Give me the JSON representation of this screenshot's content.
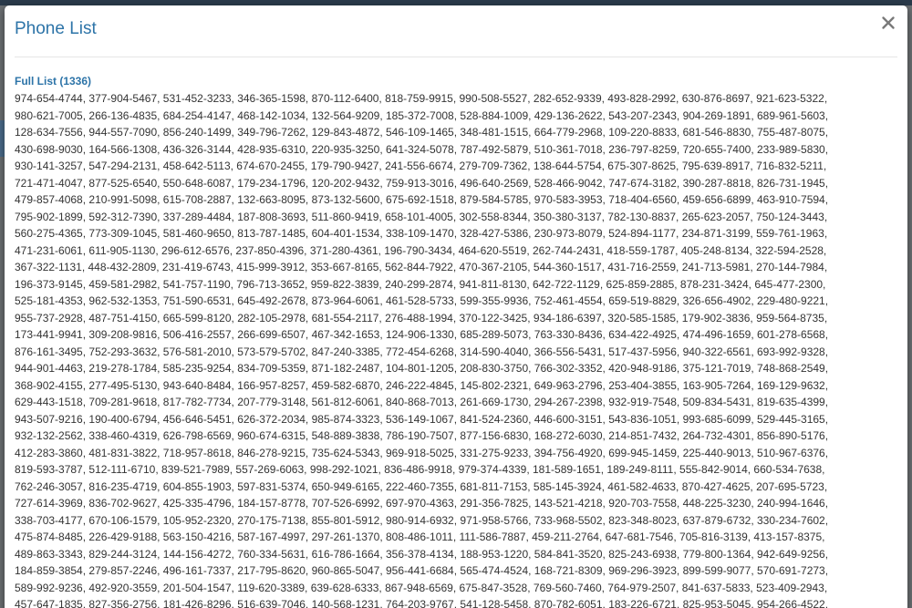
{
  "modal": {
    "title": "Phone List",
    "close_label": "×",
    "list_heading": "Full List (1336)",
    "lines": [
      "974-654-4744, 377-904-5467, 531-452-3233, 346-365-1598, 870-112-6400, 818-759-9915, 990-508-5527, 282-652-9339, 493-828-2992, 630-876-8697, 921-623-5322,",
      "980-621-7005, 266-136-4835, 684-254-4147, 468-142-1034, 132-564-9209, 185-372-7008, 528-884-1009, 429-136-2622, 543-207-2343, 904-269-1891, 689-961-5603,",
      "128-634-7556, 944-557-7090, 856-240-1499, 349-796-7262, 129-843-4872, 546-109-1465, 348-481-1515, 664-779-2968, 109-220-8833, 681-546-8830, 755-487-8075,",
      "430-698-9030, 164-566-1308, 436-326-3144, 428-935-6310, 220-935-3250, 641-324-5078, 787-492-5879, 510-361-7018, 236-797-8259, 720-655-7400, 233-989-5830,",
      "930-141-3257, 547-294-2131, 458-642-5113, 674-670-2455, 179-790-9427, 241-556-6674, 279-709-7362, 138-644-5754, 675-307-8625, 795-639-8917, 716-832-5211,",
      "721-471-4047, 877-525-6540, 550-648-6087, 179-234-1796, 120-202-9432, 759-913-3016, 496-640-2569, 528-466-9042, 747-674-3182, 390-287-8818, 826-731-1945,",
      "479-857-4068, 210-991-5098, 615-708-2887, 132-663-8095, 873-132-5600, 675-692-1518, 879-584-5785, 970-583-3953, 718-404-6560, 459-656-6899, 463-910-7594,",
      "795-902-1899, 592-312-7390, 337-289-4484, 187-808-3693, 511-860-9419, 658-101-4005, 302-558-8344, 350-380-3137, 782-130-8837, 265-623-2057, 750-124-3443,",
      "560-275-4365, 773-309-1045, 581-460-9650, 813-787-1485, 604-401-1534, 338-109-1470, 328-427-5386, 230-973-8079, 524-894-1177, 234-871-3199, 559-761-1963,",
      "471-231-6061, 611-905-1130, 296-612-6576, 237-850-4396, 371-280-4361, 196-790-3434, 464-620-5519, 262-744-2431, 418-559-1787, 405-248-8134, 322-594-2528,",
      "367-322-1131, 448-432-2809, 231-419-6743, 415-999-3912, 353-667-8165, 562-844-7922, 470-367-2105, 544-360-1517, 431-716-2559, 241-713-5981, 270-144-7984,",
      "196-373-9145, 459-581-2982, 541-757-1190, 796-713-3652, 959-822-3839, 240-299-2874, 941-811-8130, 642-722-1129, 625-859-2885, 878-231-3424, 645-477-2300,",
      "525-181-4353, 962-532-1353, 751-590-6531, 645-492-2678, 873-964-6061, 461-528-5733, 599-355-9936, 752-461-4554, 659-519-8829, 326-656-4902, 229-480-9221,",
      "955-737-2928, 487-751-4150, 665-599-8120, 282-105-2978, 681-554-2117, 276-488-1994, 370-122-3425, 934-186-6397, 320-585-1585, 179-902-3836, 959-564-8735,",
      "173-441-9941, 309-208-9816, 506-416-2557, 266-699-6507, 467-342-1653, 124-906-1330, 685-289-5073, 763-330-8436, 634-422-4925, 474-496-1659, 601-278-6568,",
      "876-161-3495, 752-293-3632, 576-581-2010, 573-579-5702, 847-240-3385, 772-454-6268, 314-590-4040, 366-556-5431, 517-437-5956, 940-322-6561, 693-992-9328,",
      "944-901-4463, 219-278-1784, 585-235-9254, 834-709-5359, 871-182-2487, 104-801-1205, 208-830-3750, 766-302-3352, 420-948-9186, 375-121-7019, 748-868-2549,",
      "368-902-4155, 277-495-5130, 943-640-8484, 166-957-8257, 459-582-6870, 246-222-4845, 145-802-2321, 649-963-2796, 253-404-3855, 163-905-7264, 169-129-9632,",
      "629-443-1518, 709-281-9618, 817-782-7734, 207-779-3148, 561-812-6061, 840-868-7013, 261-669-1730, 294-267-2398, 932-919-7548, 509-834-5431, 819-635-4399,",
      "943-507-9216, 190-400-6794, 456-646-5451, 626-372-2034, 985-874-3323, 536-149-1067, 841-524-2360, 446-600-3151, 543-836-1051, 993-685-6099, 529-445-3165,",
      "932-132-2562, 338-460-4319, 626-798-6569, 960-674-6315, 548-889-3838, 786-190-7507, 877-156-6830, 168-272-6030, 214-851-7432, 264-732-4301, 856-890-5176,",
      "412-283-3860, 481-831-3822, 718-957-8618, 846-278-9215, 735-624-5343, 969-918-5025, 331-275-9233, 394-756-4920, 699-945-1459, 225-440-9013, 510-967-6376,",
      "819-593-3787, 512-111-6710, 839-521-7989, 557-269-6063, 998-292-1021, 836-486-9918, 979-374-4339, 181-589-1651, 189-249-8111, 555-842-9014, 660-534-7638,",
      "762-246-3057, 816-235-4719, 604-855-1903, 597-831-5374, 650-949-6165, 222-460-7355, 681-811-7153, 585-145-3924, 461-582-4633, 870-427-4625, 207-695-5723,",
      "727-614-3969, 836-702-9627, 425-335-4796, 184-157-8778, 707-526-6992, 697-970-4363, 291-356-7825, 143-521-4218, 920-703-7558, 448-225-3230, 240-994-1646,",
      "338-703-4177, 670-106-1579, 105-952-2320, 270-175-7138, 855-801-5912, 980-914-6932, 971-958-5766, 733-968-5502, 823-348-8023, 637-879-6732, 330-234-7602,",
      "475-874-8485, 226-429-9188, 563-150-4216, 587-167-4997, 297-261-1370, 808-486-1011, 111-586-7887, 459-211-2764, 647-681-7546, 705-816-3139, 413-157-8375,",
      "489-863-3343, 829-244-3124, 144-156-4272, 760-334-5631, 616-786-1664, 356-378-4134, 188-953-1220, 584-841-3520, 825-243-6938, 779-800-1364, 942-649-9256,",
      "184-859-3854, 279-857-2246, 496-161-7337, 217-795-8620, 960-865-5047, 956-441-6684, 565-474-4524, 168-721-8309, 969-296-3923, 899-599-9077, 570-691-7273,",
      "589-992-9236, 492-920-3559, 201-504-1547, 119-620-3389, 639-628-6333, 867-948-6569, 675-847-3528, 769-560-7460, 764-979-2507, 841-637-5833, 523-409-2943,",
      "457-647-1835, 827-356-2756, 181-426-8296, 516-639-7046, 140-568-1231, 764-203-9767, 541-128-5458, 870-782-6051, 183-226-6721, 825-953-5045, 954-266-4522,"
    ]
  }
}
